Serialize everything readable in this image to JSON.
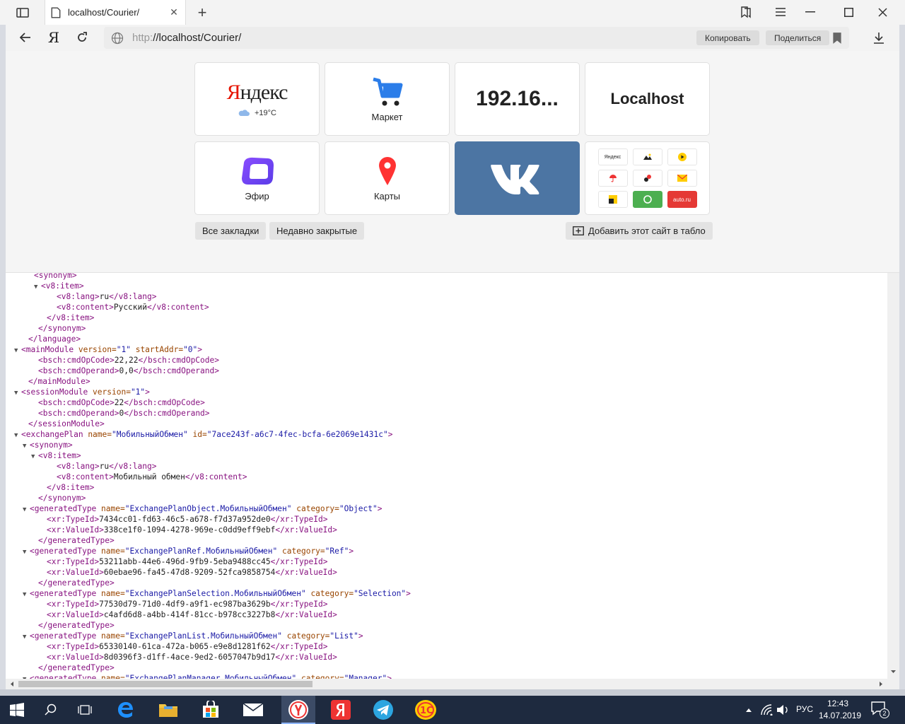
{
  "browser": {
    "tab_title": "localhost/Courier/",
    "url_scheme": "http:",
    "url_rest": "//localhost/Courier/",
    "copy_label": "Копировать",
    "share_label": "Поделиться",
    "yandex_letter": "Я"
  },
  "tableau": {
    "yandex": {
      "logo_first": "Я",
      "logo_rest": "ндекс",
      "weather": "+19°C"
    },
    "market_label": "Маркет",
    "ip_label": "192.16...",
    "localhost_label": "Localhost",
    "efir_label": "Эфир",
    "maps_label": "Карты",
    "grid": {
      "yandex_mini": "Яндекс",
      "auto_mini": "auto.ru"
    },
    "all_bookmarks": "Все закладки",
    "recently_closed": "Недавно закрытые",
    "add_site": "Добавить этот сайт в табло"
  },
  "xml_lines": [
    "    <synonym>",
    "▼ <v8:item>",
    "      <v8:lang>ru</v8:lang>",
    "      <v8:content>Русский</v8:content>",
    "    </v8:item>",
    "   </synonym>",
    "  </language>",
    "▼<mainModule version=\"1\" startAddr=\"0\">",
    "   <bsch:cmdOpCode>22,22</bsch:cmdOpCode>",
    "   <bsch:cmdOperand>0,0</bsch:cmdOperand>",
    "  </mainModule>",
    "▼<sessionModule version=\"1\">",
    "   <bsch:cmdOpCode>22</bsch:cmdOpCode>",
    "   <bsch:cmdOperand>0</bsch:cmdOperand>",
    "  </sessionModule>",
    "▼<exchangePlan name=\"МобильныйОбмен\" id=\"7ace243f-a6c7-4fec-bcfa-6e2069e1431c\">",
    "▼<synonym>",
    "▼<v8:item>",
    "      <v8:lang>ru</v8:lang>",
    "      <v8:content>Мобильный обмен</v8:content>",
    "    </v8:item>",
    "   </synonym>",
    "▼<generatedType name=\"ExchangePlanObject.МобильныйОбмен\" category=\"Object\">",
    "    <xr:TypeId>7434cc01-fd63-46c5-a678-f7d37a952de0</xr:TypeId>",
    "    <xr:ValueId>338ce1f0-1094-4278-969e-c0dd9eff9ebf</xr:ValueId>",
    "   </generatedType>",
    "▼<generatedType name=\"ExchangePlanRef.МобильныйОбмен\" category=\"Ref\">",
    "    <xr:TypeId>53211abb-44e6-496d-9fb9-5eba9488cc45</xr:TypeId>",
    "    <xr:ValueId>60ebae96-fa45-47d8-9209-52fca9858754</xr:ValueId>",
    "   </generatedType>",
    "▼<generatedType name=\"ExchangePlanSelection.МобильныйОбмен\" category=\"Selection\">",
    "    <xr:TypeId>77530d79-71d0-4df9-a9f1-ec987ba3629b</xr:TypeId>",
    "    <xr:ValueId>c4afd6d8-a4bb-414f-81cc-b978cc3227b8</xr:ValueId>",
    "   </generatedType>",
    "▼<generatedType name=\"ExchangePlanList.МобильныйОбмен\" category=\"List\">",
    "    <xr:TypeId>65330140-61ca-472a-b065-e9e8d1281f62</xr:TypeId>",
    "    <xr:ValueId>8d0396f3-d1ff-4ace-9ed2-6057047b9d17</xr:ValueId>",
    "   </generatedType>",
    "▼<generatedType name=\"ExchangePlanManager.МобильныйОбмен\" category=\"Manager\">"
  ],
  "taskbar": {
    "language": "РУС",
    "time": "12:43",
    "date": "14.07.2019",
    "notifications": "2"
  },
  "colors": {
    "accent_red": "#e61400",
    "vk_blue": "#4c75a3",
    "taskbar": "#1e2a3f"
  }
}
